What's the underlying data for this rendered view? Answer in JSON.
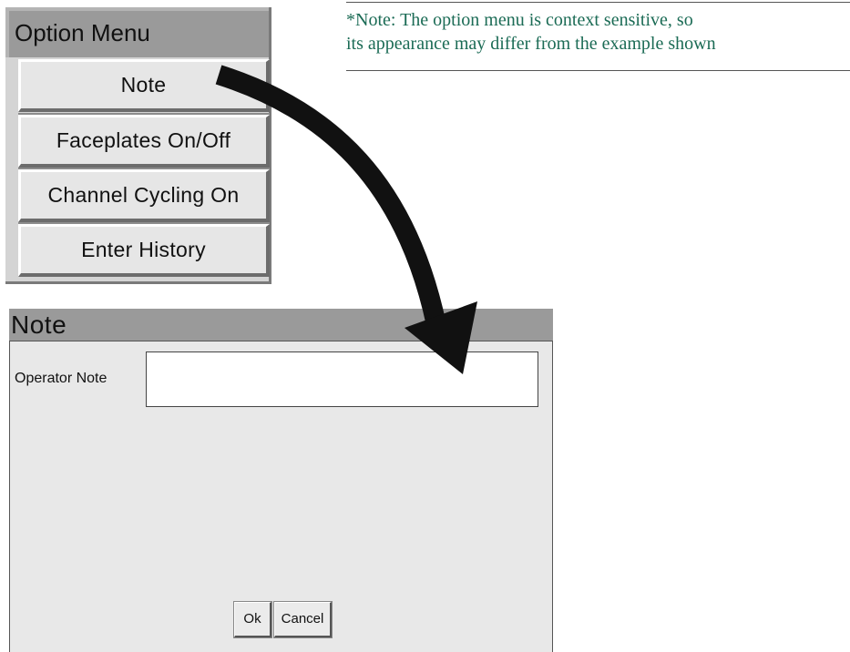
{
  "option_menu": {
    "title": "Option Menu",
    "items": [
      {
        "label": "Note"
      },
      {
        "label": "Faceplates On/Off"
      },
      {
        "label": "Channel Cycling On"
      },
      {
        "label": "Enter History"
      }
    ]
  },
  "footnote": {
    "line1": "*Note:  The option menu is context sensitive, so",
    "line2": "its appearance may differ from the example shown",
    "color": "#1b6b55"
  },
  "note_dialog": {
    "title": "Note",
    "operator_note_label": "Operator Note",
    "operator_note_value": "",
    "ok_label": "Ok",
    "cancel_label": "Cancel"
  },
  "arrow": {
    "icon": "curved-arrow-icon",
    "color": "#111111"
  }
}
